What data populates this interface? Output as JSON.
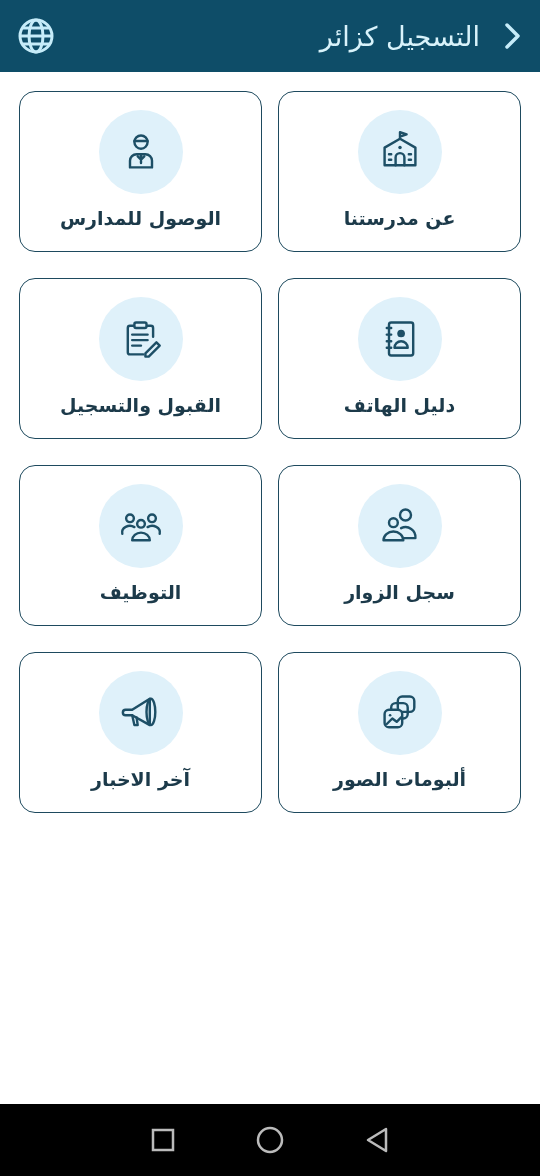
{
  "header": {
    "title": "التسجيل كزائر"
  },
  "tiles": [
    {
      "label": "عن مدرستنا"
    },
    {
      "label": "الوصول للمدارس"
    },
    {
      "label": "دليل الهاتف"
    },
    {
      "label": "القبول والتسجيل"
    },
    {
      "label": "سجل الزوار"
    },
    {
      "label": "التوظيف"
    },
    {
      "label": "ألبومات الصور"
    },
    {
      "label": "آخر الاخبار"
    }
  ]
}
